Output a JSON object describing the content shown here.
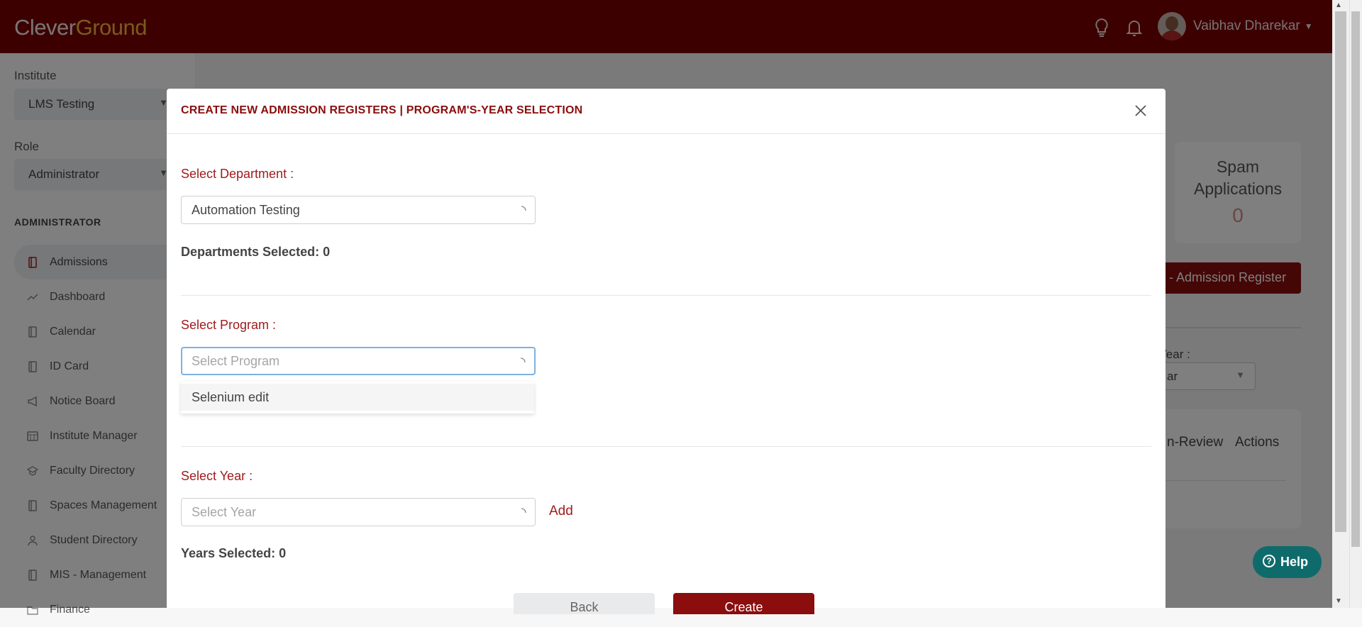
{
  "app": {
    "logo_part1": "Clever",
    "logo_part2": "Ground",
    "user_name": "Vaibhav Dharekar",
    "colors": {
      "brand": "#7b0000",
      "accent": "#8b0d0d",
      "logo_accent": "#f0b63a",
      "help": "#0f6b6b"
    }
  },
  "sidebar": {
    "institute_label": "Institute",
    "institute_value": "LMS Testing",
    "role_label": "Role",
    "role_value": "Administrator",
    "section_title": "ADMINISTRATOR",
    "items": [
      {
        "label": "Admissions",
        "icon": "book-icon"
      },
      {
        "label": "Dashboard",
        "icon": "trend-icon"
      },
      {
        "label": "Calendar",
        "icon": "calendar-book-icon"
      },
      {
        "label": "ID Card",
        "icon": "id-book-icon"
      },
      {
        "label": "Notice Board",
        "icon": "megaphone-icon"
      },
      {
        "label": "Institute Manager",
        "icon": "grid-calendar-icon"
      },
      {
        "label": "Faculty Directory",
        "icon": "graduation-cap-icon"
      },
      {
        "label": "Spaces Management",
        "icon": "book-icon"
      },
      {
        "label": "Student Directory",
        "icon": "user-icon"
      },
      {
        "label": "MIS - Management",
        "icon": "book-icon"
      },
      {
        "label": "Finance",
        "icon": "folder-icon"
      }
    ]
  },
  "background": {
    "spam_title": "Spam Applications",
    "spam_count": "0",
    "register_button": "- Admission Register",
    "year_label": "Year :",
    "year_value": "ar",
    "col_review": "n-Review",
    "col_actions": "Actions"
  },
  "modal": {
    "title": "CREATE NEW ADMISSION REGISTERS | PROGRAM'S-YEAR SELECTION",
    "department": {
      "label": "Select Department :",
      "value": "Automation Testing",
      "count_text": "Departments Selected: 0"
    },
    "program": {
      "label": "Select Program :",
      "placeholder": "Select Program",
      "options": [
        "Selenium edit"
      ]
    },
    "year": {
      "label": "Select Year :",
      "placeholder": "Select Year",
      "add_label": "Add",
      "count_text": "Years Selected: 0"
    },
    "back_label": "Back",
    "create_label": "Create"
  },
  "help_label": "Help"
}
